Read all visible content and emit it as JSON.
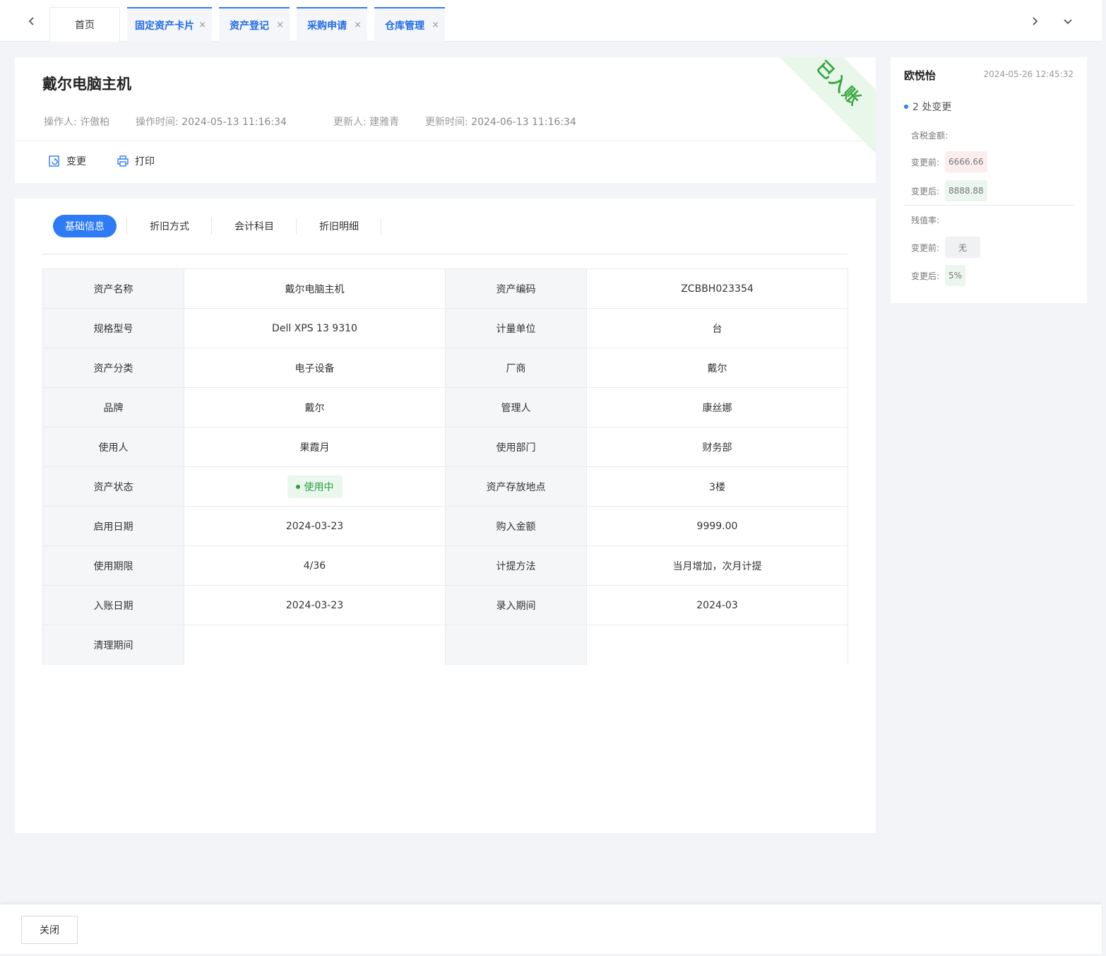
{
  "tabs": [
    {
      "label": "首页",
      "closable": false
    },
    {
      "label": "固定资产卡片",
      "closable": true
    },
    {
      "label": "资产登记",
      "closable": true
    },
    {
      "label": "采购申请",
      "closable": true
    },
    {
      "label": "仓库管理",
      "closable": true
    }
  ],
  "tab_close_glyph": "×",
  "header": {
    "title": "戴尔电脑主机",
    "operator_label": "操作人:",
    "operator": "许傲柏",
    "op_time_label": "操作时间:",
    "op_time": "2024-05-13 11:16:34",
    "updater_label": "更新人:",
    "updater": "建雅青",
    "update_time_label": "更新时间:",
    "update_time": "2024-06-13 11:16:34",
    "change_label": "变更",
    "print_label": "打印",
    "ribbon": "已入账"
  },
  "subtabs": [
    "基础信息",
    "折旧方式",
    "会计科目",
    "折旧明细"
  ],
  "info_rows": [
    [
      "资产名称",
      "戴尔电脑主机",
      "资产编码",
      "ZCBBH023354"
    ],
    [
      "规格型号",
      "Dell XPS 13 9310",
      "计量单位",
      "台"
    ],
    [
      "资产分类",
      "电子设备",
      "厂商",
      "戴尔"
    ],
    [
      "品牌",
      "戴尔",
      "管理人",
      "康丝娜"
    ],
    [
      "使用人",
      "果霞月",
      "使用部门",
      "财务部"
    ],
    [
      "资产状态",
      "使用中",
      "资产存放地点",
      "3楼"
    ],
    [
      "启用日期",
      "2024-03-23",
      "购入金额",
      "9999.00"
    ],
    [
      "使用期限",
      "4/36",
      "计提方法",
      "当月增加，次月计提"
    ],
    [
      "入账日期",
      "2024-03-23",
      "录入期间",
      "2024-03"
    ],
    [
      "清理期间",
      "",
      "",
      ""
    ]
  ],
  "side": {
    "user": "欧悦怡",
    "time": "2024-05-26 12:45:32",
    "count_text": "2 处变更",
    "field1": "含税金额:",
    "before_label": "变更前:",
    "after_label": "变更后:",
    "field1_before": "6666.66",
    "field1_after": "8888.88",
    "field2": "残值率:",
    "field2_before": "无",
    "field2_after": "5%"
  },
  "footer": {
    "close_label": "关闭"
  },
  "colors": {
    "accent": "#2e7bf5",
    "success": "#2fa043",
    "page_bg": "#f2f4f7"
  }
}
